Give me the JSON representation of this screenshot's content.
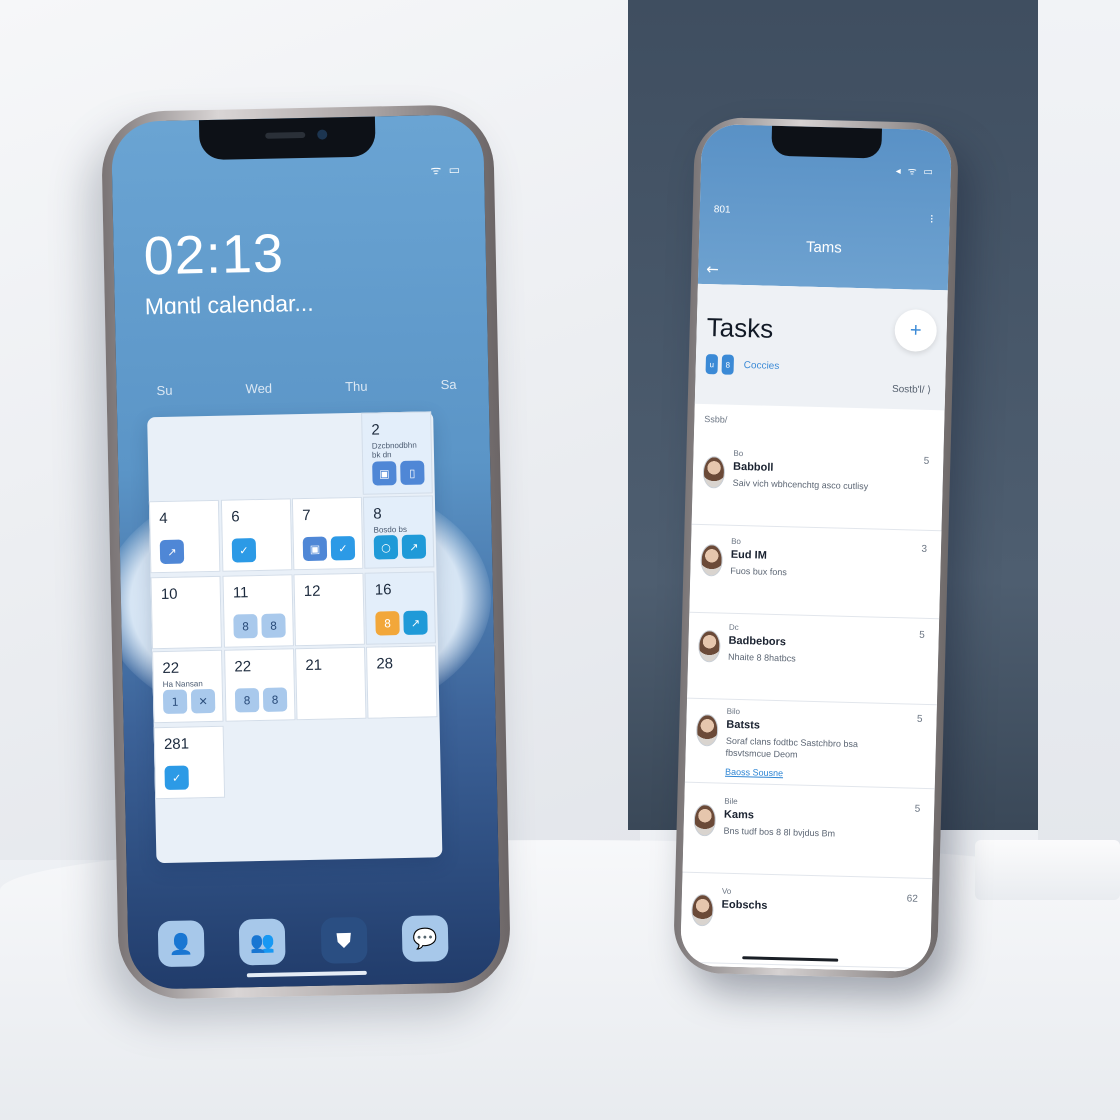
{
  "calendar_phone": {
    "time": "02:13",
    "subtitle": "Mɑntl calendar...",
    "status_icons": "ᯤ ▭",
    "weekdays": [
      "Su",
      "Wed",
      "Thu",
      "Sa"
    ],
    "cells": [
      {
        "num": "2",
        "note": "Dzcbnodbhn bk dn",
        "badges": [
          {
            "g": "▣",
            "c": "blue"
          },
          {
            "g": "▯",
            "c": "blue"
          }
        ]
      },
      {
        "num": "4",
        "note": "",
        "badges": [
          {
            "g": "↗",
            "c": "blue"
          }
        ]
      },
      {
        "num": "6",
        "note": "",
        "badges": [
          {
            "g": "✓",
            "c": "sky"
          }
        ]
      },
      {
        "num": "7",
        "note": "",
        "badges": [
          {
            "g": "▣",
            "c": "blue"
          },
          {
            "g": "✓",
            "c": "sky"
          }
        ]
      },
      {
        "num": "8",
        "note": "Bosdo bs",
        "badges": [
          {
            "g": "○",
            "c": "teal"
          },
          {
            "g": "↗",
            "c": "teal"
          }
        ]
      },
      {
        "num": "10",
        "note": "",
        "badges": []
      },
      {
        "num": "11",
        "note": "",
        "badges": [
          {
            "g": "8",
            "c": "pale"
          },
          {
            "g": "8",
            "c": "pale"
          }
        ]
      },
      {
        "num": "12",
        "note": "",
        "badges": []
      },
      {
        "num": "16",
        "note": "",
        "badges": [
          {
            "g": "8",
            "c": "orange"
          },
          {
            "g": "↗",
            "c": "teal"
          }
        ]
      },
      {
        "num": "22",
        "note": "Ha Nansan",
        "badges": [
          {
            "g": "1",
            "c": "pale"
          },
          {
            "g": "✕",
            "c": "pale"
          }
        ]
      },
      {
        "num": "22",
        "note": "",
        "badges": [
          {
            "g": "8",
            "c": "pale"
          },
          {
            "g": "8",
            "c": "pale"
          }
        ]
      },
      {
        "num": "21",
        "note": "",
        "badges": []
      },
      {
        "num": "28",
        "note": "",
        "badges": []
      },
      {
        "num": "281",
        "note": "",
        "badges": [
          {
            "g": "✓",
            "c": "sky"
          }
        ]
      }
    ],
    "dock": [
      {
        "icon": "person-icon",
        "glyph": "👤"
      },
      {
        "icon": "people-icon",
        "glyph": "👥"
      },
      {
        "icon": "shield-icon",
        "glyph": "⛊"
      },
      {
        "icon": "chat-icon",
        "glyph": "💬"
      }
    ]
  },
  "tasks_phone": {
    "status_time": "801",
    "status_icons": "◂ ᯤ ▭",
    "more_glyph": "⁝",
    "header_title": "Tams",
    "back_glyph": "←",
    "title": "Tasks",
    "add_glyph": "+",
    "chips": [
      "u",
      "8"
    ],
    "chip_label": "Coccies",
    "sort_label": "Sostb'l/ ⟩",
    "section_label": "Ssbb/",
    "rows": [
      {
        "small": "Bo",
        "name": "Babboll",
        "desc": "Saiv vich wbhcenchtg asco cutlisy",
        "link": "",
        "count": "5"
      },
      {
        "small": "Bo",
        "name": "Eud IM",
        "desc": "Fuos bux fons",
        "link": "",
        "count": "3"
      },
      {
        "small": "Dc",
        "name": "Badbebors",
        "desc": "Nhaite 8 8hatbcs",
        "link": "",
        "count": "5"
      },
      {
        "small": "Bilo",
        "name": "Batsts",
        "desc": "Soraf clans fodtbc Sastchbro bsa fbsvtsmcue Deom",
        "link": "Baoss Sousne",
        "count": "5"
      },
      {
        "small": "Bile",
        "name": "Kams",
        "desc": "Bns tudf bos 8 8l bvjdus Bm",
        "link": "",
        "count": "5"
      },
      {
        "small": "Vo",
        "name": "Eobschs",
        "desc": "",
        "link": "",
        "count": "62"
      }
    ]
  }
}
